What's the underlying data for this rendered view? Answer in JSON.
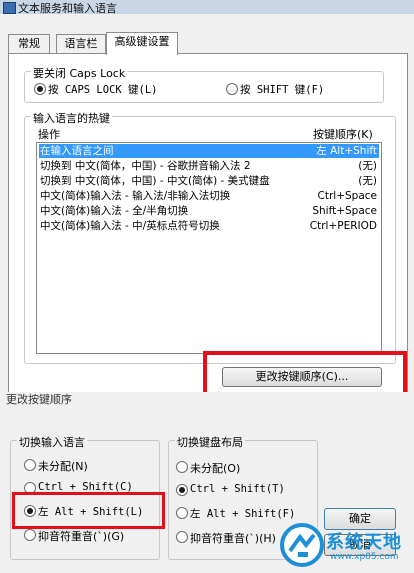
{
  "window": {
    "title": "文本服务和输入语言"
  },
  "tabs": [
    {
      "label": "常规"
    },
    {
      "label": "语言栏"
    },
    {
      "label": "高级键设置"
    }
  ],
  "caps_group": {
    "legend": "要关闭 Caps Lock",
    "option_caps": "按 CAPS LOCK 键(L)",
    "option_shift": "按 SHIFT 键(F)",
    "selected": "option_caps"
  },
  "hotkeys_group": {
    "legend": "输入语言的热键",
    "col_action": "操作",
    "col_keys": "按键顺序(K)",
    "rows": [
      {
        "action": "在输入语言之间",
        "keys": "左 Alt+Shift",
        "selected": true
      },
      {
        "action": "切换到 中文(简体，中国) - 谷歌拼音输入法 2",
        "keys": "(无)"
      },
      {
        "action": "切换到 中文(简体，中国) - 中文(简体) - 美式键盘",
        "keys": "(无)"
      },
      {
        "action": "中文(简体)输入法 - 输入法/非输入法切换",
        "keys": "Ctrl+Space"
      },
      {
        "action": "中文(简体)输入法 - 全/半角切换",
        "keys": "Shift+Space"
      },
      {
        "action": "中文(简体)输入法 - 中/英标点符号切换",
        "keys": "Ctrl+PERIOD"
      }
    ],
    "change_button": "更改按键顺序(C)..."
  },
  "change_dialog": {
    "title": "更改按键顺序",
    "input_lang": {
      "legend": "切换输入语言",
      "options": [
        "未分配(N)",
        "Ctrl + Shift(C)",
        "左 Alt + Shift(L)",
        "抑音符重音(`)(G)"
      ],
      "selected_index": 2
    },
    "keyboard_layout": {
      "legend": "切换键盘布局",
      "options": [
        "未分配(O)",
        "Ctrl + Shift(T)",
        "左 Alt + Shift(F)",
        "抑音符重音(`)(H)"
      ],
      "selected_index": 1
    },
    "ok_button": "确定",
    "cancel_button": "取消"
  },
  "watermark": {
    "text": "系统天地",
    "url": "www.xp85.com"
  },
  "colors": {
    "selection": "#3399ff",
    "highlight_box": "#e3101b",
    "watermark": "#1d8fd6"
  }
}
